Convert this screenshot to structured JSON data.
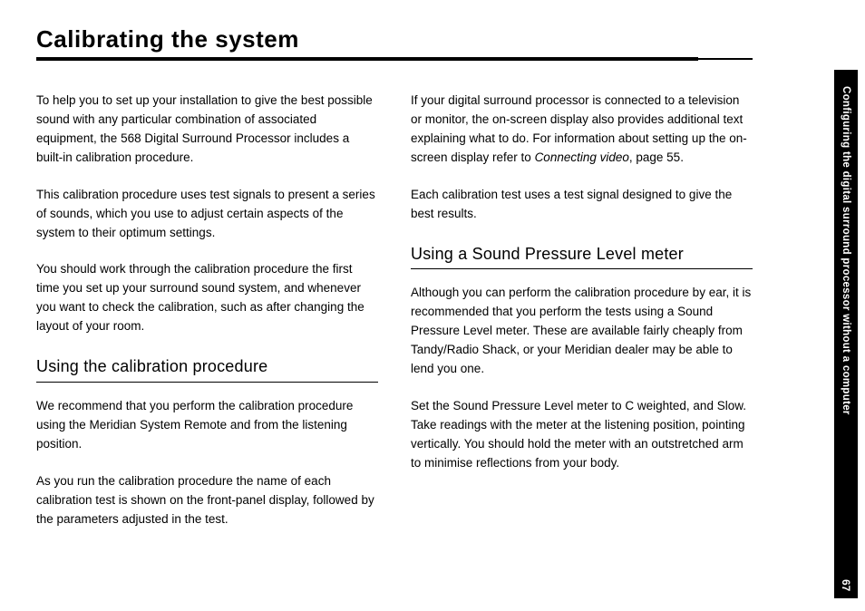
{
  "title": "Calibrating the system",
  "left": {
    "p1": "To help you to set up your installation to give the best possible sound with any particular combination of associated equipment, the 568 Digital Surround Processor includes a built-in calibration procedure.",
    "p2": "This calibration procedure uses test signals to present a series of sounds, which you use to adjust certain aspects of the system to their optimum settings.",
    "p3": "You should work through the calibration procedure the first time you set up your surround sound system, and whenever you want to check the calibration, such as after changing the layout of your room.",
    "h1": "Using the calibration procedure",
    "p4": "We recommend that you perform the calibration procedure using the Meridian System Remote and from the listening position.",
    "p5": "As you run the calibration procedure the name of each calibration test is shown on the front-panel display, followed by the parameters adjusted in the test."
  },
  "right": {
    "p1a": "If your digital surround processor is connected to a television or monitor, the on-screen display also provides additional text explaining what to do. For information about setting up the on-screen display refer to ",
    "p1_em": "Connecting video",
    "p1b": ", page 55.",
    "p2": "Each calibration test uses a test signal designed to give the best results.",
    "h1": "Using a Sound Pressure Level meter",
    "p3": "Although you can perform the calibration procedure by ear, it is recommended that you perform the tests using a Sound Pressure Level meter. These are available fairly cheaply from Tandy/Radio Shack, or your Meridian dealer may be able to lend you one.",
    "p4": "Set the Sound Pressure Level meter to C weighted, and Slow. Take readings with the meter at the listening position, pointing vertically. You should hold the meter with an outstretched arm to minimise reflections from your body."
  },
  "sidebar": {
    "chapter": "Configuring the digital surround processor without a computer",
    "page": "67"
  }
}
